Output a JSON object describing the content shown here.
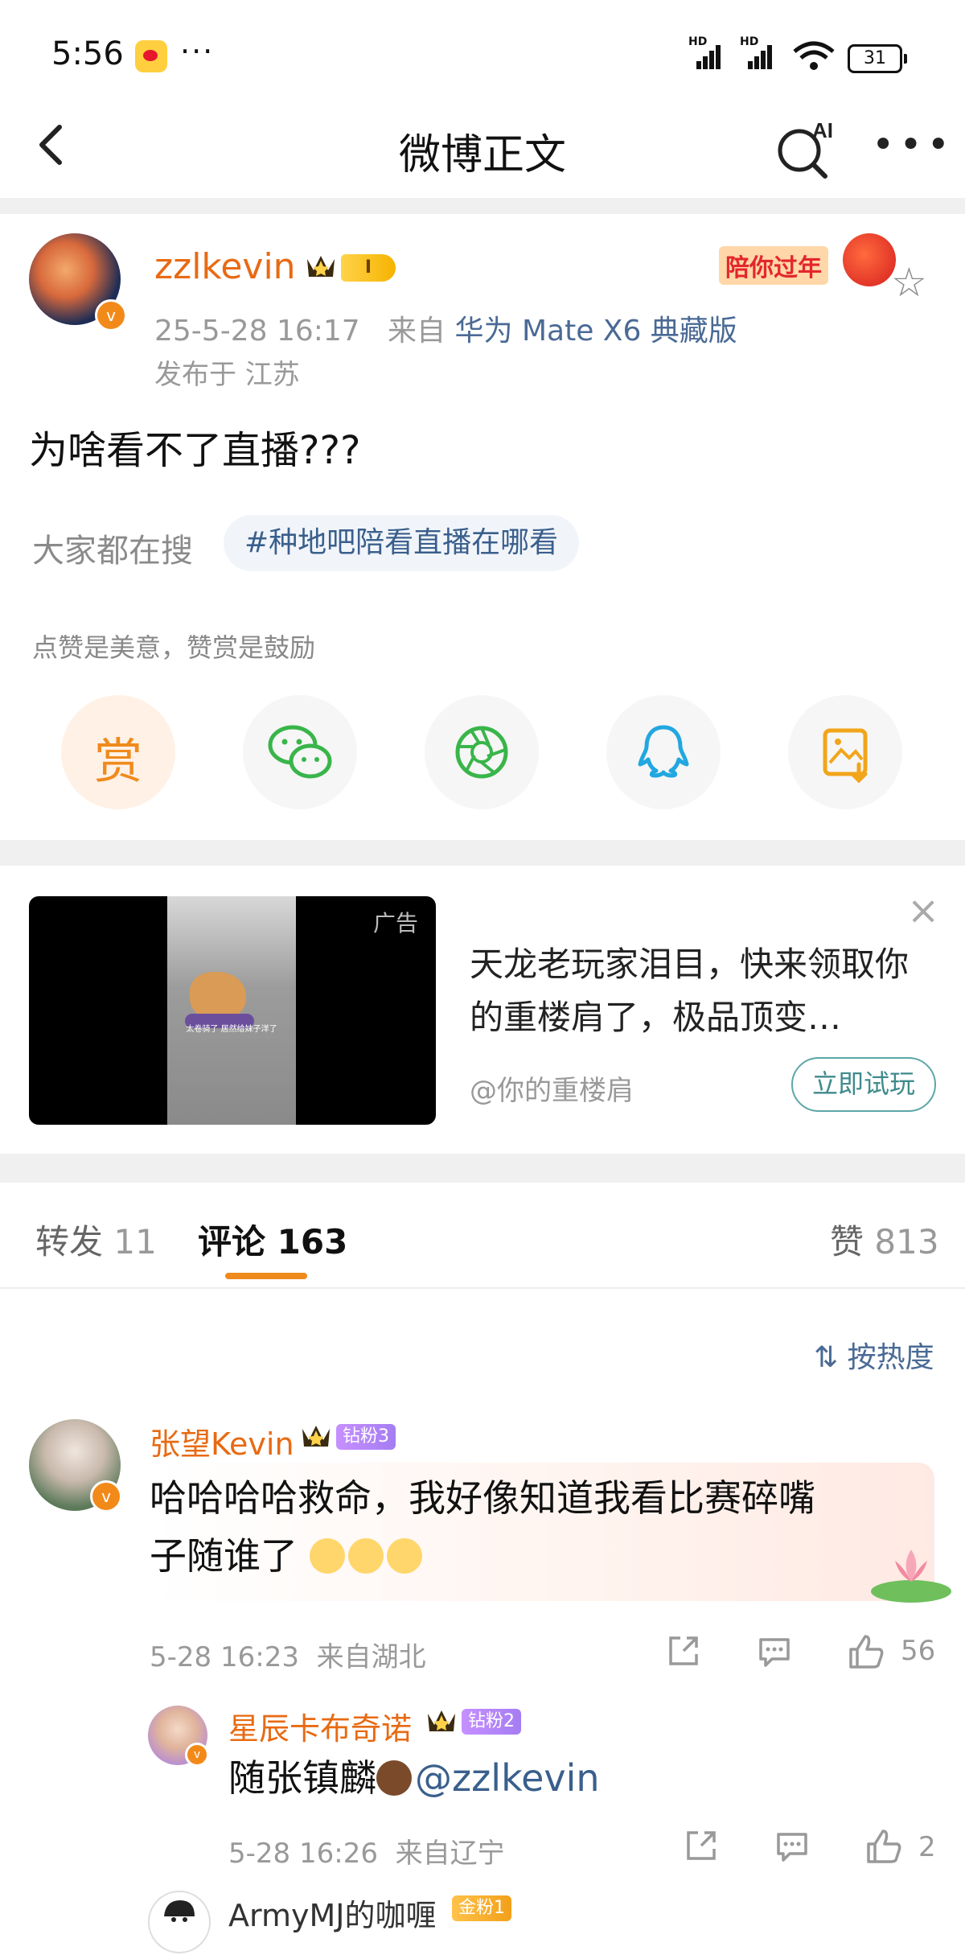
{
  "status_bar": {
    "time": "5:56",
    "dots": "···",
    "battery": "31"
  },
  "nav": {
    "title": "微博正文"
  },
  "post": {
    "username": "zzlkevin",
    "level_badge": "I",
    "date": "25-5-28 16:17",
    "from_label": "来自",
    "source": "华为 Mate X6 典藏版",
    "location": "发布于 江苏",
    "banner_text": "陪你过年",
    "content": "为啥看不了直播???",
    "search_label": "大家都在搜",
    "search_tag": "#种地吧陪看直播在哪看",
    "reward_hint": "点赞是美意，赞赏是鼓励",
    "reward_glyph": "赏"
  },
  "ad": {
    "tag": "广告",
    "video_caption": "太卷骑了 居然给妹子洋了",
    "title": "天龙老玩家泪目，快来领取你的重楼肩了，极品顶变…",
    "source": "@你的重楼肩",
    "cta": "立即试玩"
  },
  "tabs": {
    "repost_label": "转发",
    "repost_count": "11",
    "comment_label": "评论",
    "comment_count": "163",
    "like_label": "赞",
    "like_count": "813"
  },
  "sort_label": "按热度",
  "comments": [
    {
      "name": "张望Kevin",
      "badge": "钻粉3",
      "text_line1": "哈哈哈哈救命，我好像知道我看比赛碎嘴",
      "text_line2": "子随谁了",
      "time": "5-28 16:23",
      "location": "来自湖北",
      "likes": "56"
    },
    {
      "name": "星辰卡布奇诺",
      "badge": "钻粉2",
      "text": "随张镇麟",
      "mention": "@zzlkevin",
      "time": "5-28 16:26",
      "location": "来自辽宁",
      "likes": "2"
    },
    {
      "name": "ArmyMJ的咖喱",
      "badge": "金粉1"
    }
  ],
  "colors": {
    "accent": "#e86a13",
    "link": "#3a5f8c",
    "underline": "#f08a1c"
  }
}
